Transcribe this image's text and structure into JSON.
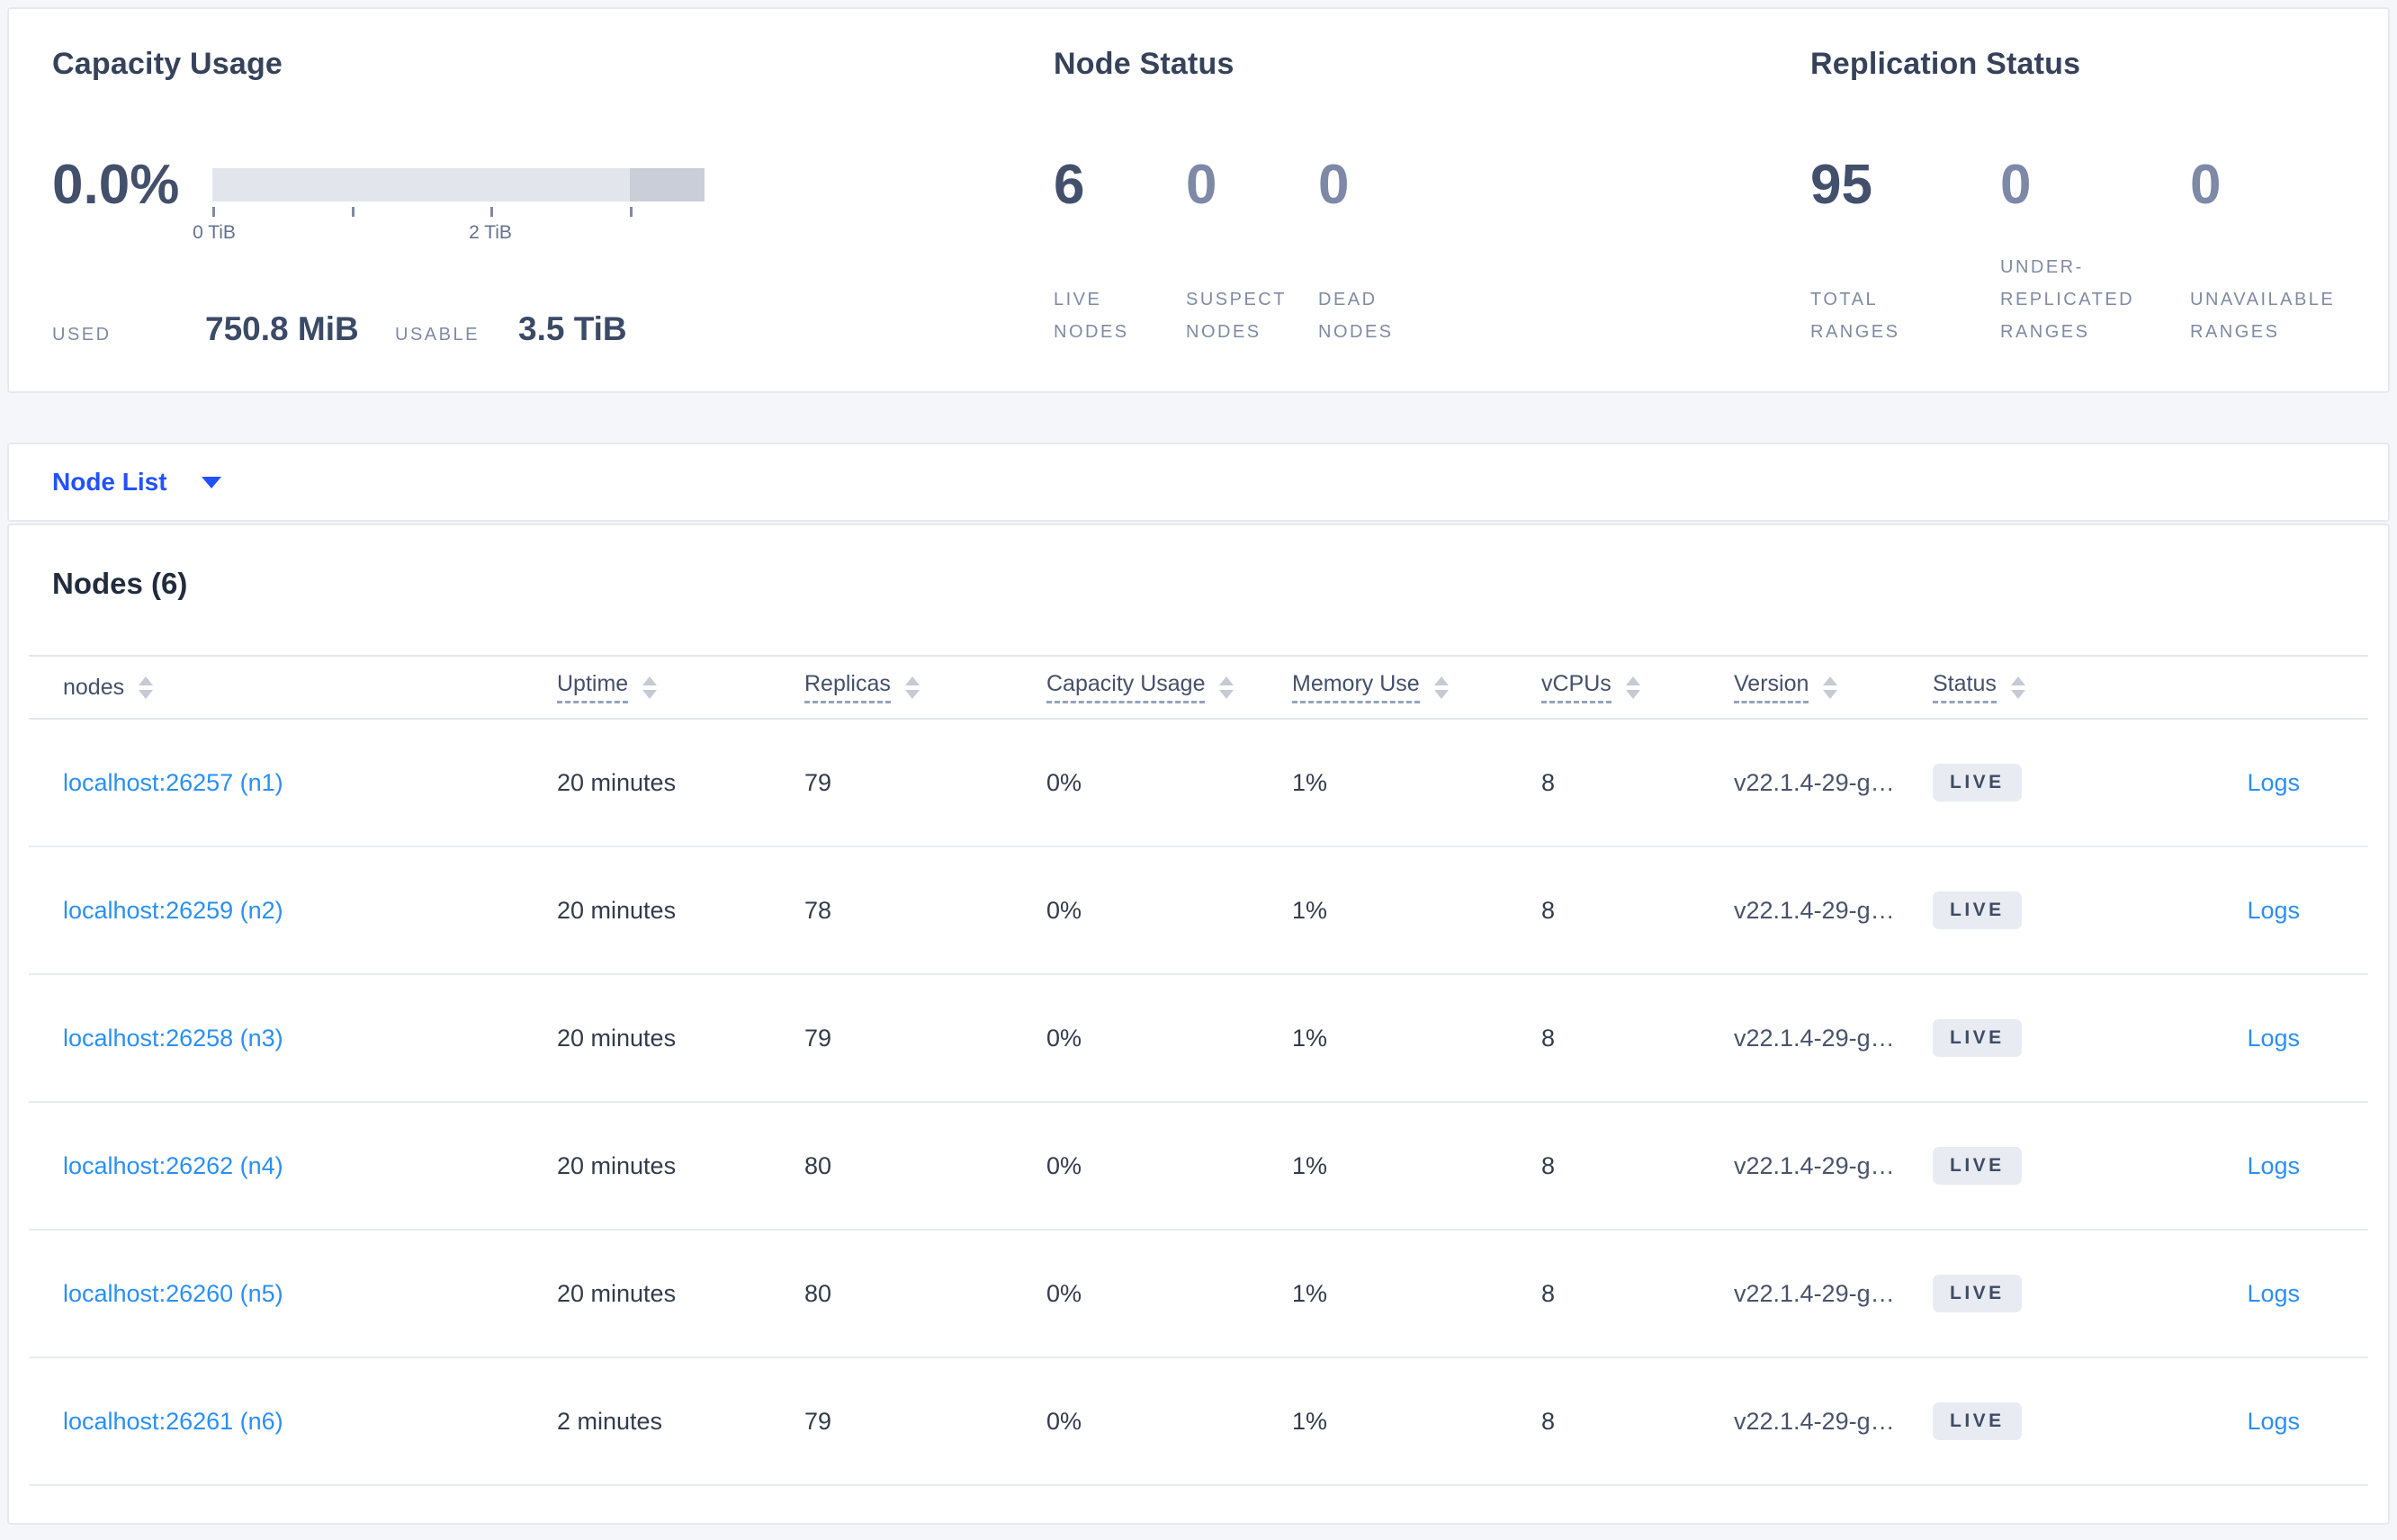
{
  "capacity": {
    "title": "Capacity Usage",
    "percent": "0.0%",
    "used_label": "USED",
    "used_value": "750.8 MiB",
    "usable_label": "USABLE",
    "usable_value": "3.5 TiB",
    "bar": {
      "tick_labels": [
        "0 TiB",
        "2 TiB"
      ],
      "tick_positions_tib": [
        0,
        1,
        2,
        3
      ],
      "bar_end_tib": 3.5,
      "fill_color": "#e2e5ec",
      "end_segment_color": "#c9ced8"
    }
  },
  "node_status": {
    "title": "Node Status",
    "stats": [
      {
        "value": "6",
        "label": "LIVE NODES"
      },
      {
        "value": "0",
        "label": "SUSPECT NODES"
      },
      {
        "value": "0",
        "label": "DEAD NODES"
      }
    ]
  },
  "replication": {
    "title": "Replication Status",
    "stats": [
      {
        "value": "95",
        "label": "TOTAL RANGES"
      },
      {
        "value": "0",
        "label": "UNDER-REPLICATED RANGES"
      },
      {
        "value": "0",
        "label": "UNAVAILABLE RANGES"
      }
    ]
  },
  "node_list": {
    "label": "Node List"
  },
  "nodes_table": {
    "title": "Nodes (6)",
    "headers": [
      {
        "label": "nodes"
      },
      {
        "label": "Uptime"
      },
      {
        "label": "Replicas"
      },
      {
        "label": "Capacity Usage"
      },
      {
        "label": "Memory Use"
      },
      {
        "label": "vCPUs"
      },
      {
        "label": "Version"
      },
      {
        "label": "Status"
      }
    ],
    "rows": [
      {
        "node": "localhost:26257 (n1)",
        "uptime": "20 minutes",
        "replicas": "79",
        "capacity": "0%",
        "memory": "1%",
        "vcpus": "8",
        "version": "v22.1.4-29-g…",
        "status": "LIVE",
        "logs": "Logs"
      },
      {
        "node": "localhost:26259 (n2)",
        "uptime": "20 minutes",
        "replicas": "78",
        "capacity": "0%",
        "memory": "1%",
        "vcpus": "8",
        "version": "v22.1.4-29-g…",
        "status": "LIVE",
        "logs": "Logs"
      },
      {
        "node": "localhost:26258 (n3)",
        "uptime": "20 minutes",
        "replicas": "79",
        "capacity": "0%",
        "memory": "1%",
        "vcpus": "8",
        "version": "v22.1.4-29-g…",
        "status": "LIVE",
        "logs": "Logs"
      },
      {
        "node": "localhost:26262 (n4)",
        "uptime": "20 minutes",
        "replicas": "80",
        "capacity": "0%",
        "memory": "1%",
        "vcpus": "8",
        "version": "v22.1.4-29-g…",
        "status": "LIVE",
        "logs": "Logs"
      },
      {
        "node": "localhost:26260 (n5)",
        "uptime": "20 minutes",
        "replicas": "80",
        "capacity": "0%",
        "memory": "1%",
        "vcpus": "8",
        "version": "v22.1.4-29-g…",
        "status": "LIVE",
        "logs": "Logs"
      },
      {
        "node": "localhost:26261 (n6)",
        "uptime": "2 minutes",
        "replicas": "79",
        "capacity": "0%",
        "memory": "1%",
        "vcpus": "8",
        "version": "v22.1.4-29-g…",
        "status": "LIVE",
        "logs": "Logs"
      }
    ]
  },
  "colors": {
    "accent_blue": "#2152ff",
    "link_blue": "#2b8ff2",
    "badge_bg": "#e8ebf2",
    "badge_text": "#3f4c66",
    "page_bg": "#f4f6f9"
  }
}
